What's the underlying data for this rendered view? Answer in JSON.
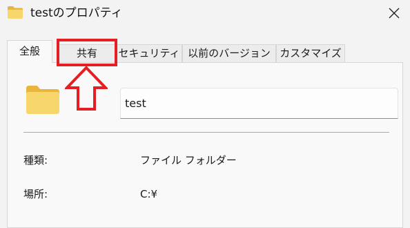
{
  "window": {
    "title": "testのプロパティ",
    "close_icon": "close-icon",
    "folder_icon": "folder-icon"
  },
  "tabs": [
    {
      "label": "全般",
      "selected": true
    },
    {
      "label": "共有",
      "selected": false
    },
    {
      "label": "セキュリティ",
      "selected": false
    },
    {
      "label": "以前のバージョン",
      "selected": false
    },
    {
      "label": "カスタマイズ",
      "selected": false
    }
  ],
  "general": {
    "name_value": "test",
    "properties": [
      {
        "label": "種類:",
        "value": "ファイル フォルダー"
      },
      {
        "label": "場所:",
        "value": "C:¥"
      }
    ]
  },
  "annotation": {
    "highlight_color": "#e41e22",
    "highlighted_tab": "共有",
    "arrow_direction": "up"
  },
  "colors": {
    "folder_body": "#f7d66c",
    "folder_tab": "#e9b63d",
    "panel_bg": "#f9f9f9",
    "window_bg": "#f3f3f3"
  }
}
